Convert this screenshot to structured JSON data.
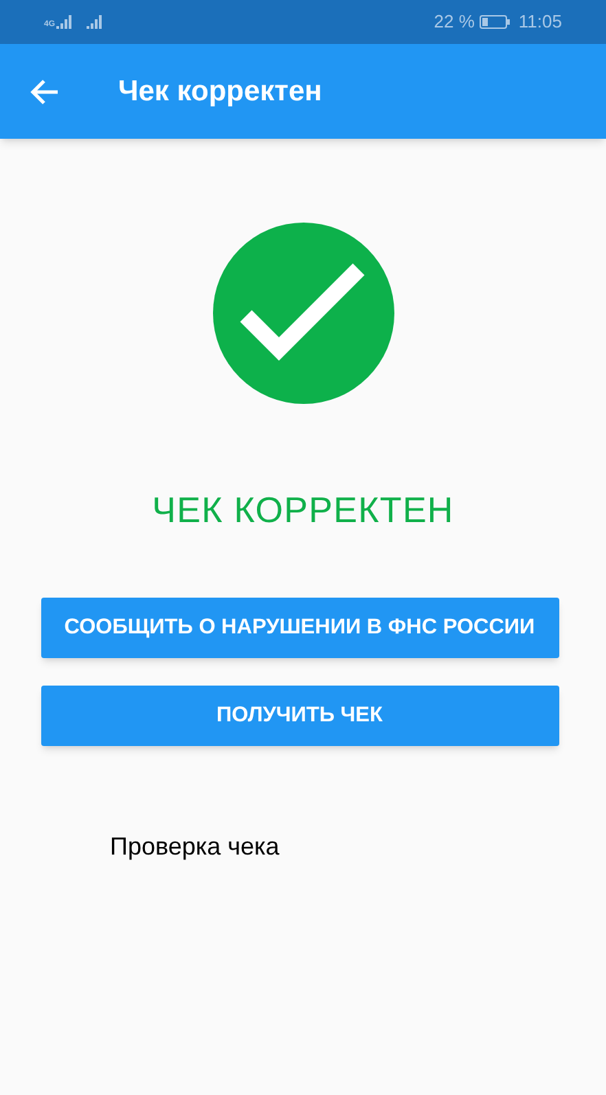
{
  "status_bar": {
    "network": "4G",
    "battery_percent": "22 %",
    "time": "11:05"
  },
  "app_bar": {
    "title": "Чек корректен"
  },
  "result": {
    "valid": true,
    "message": "ЧЕК КОРРЕКТЕН"
  },
  "buttons": [
    {
      "label": "СООБЩИТЬ О НАРУШЕНИИ В ФНС РОССИИ"
    },
    {
      "label": "ПОЛУЧИТЬ ЧЕК"
    }
  ],
  "caption": "Проверка чека"
}
